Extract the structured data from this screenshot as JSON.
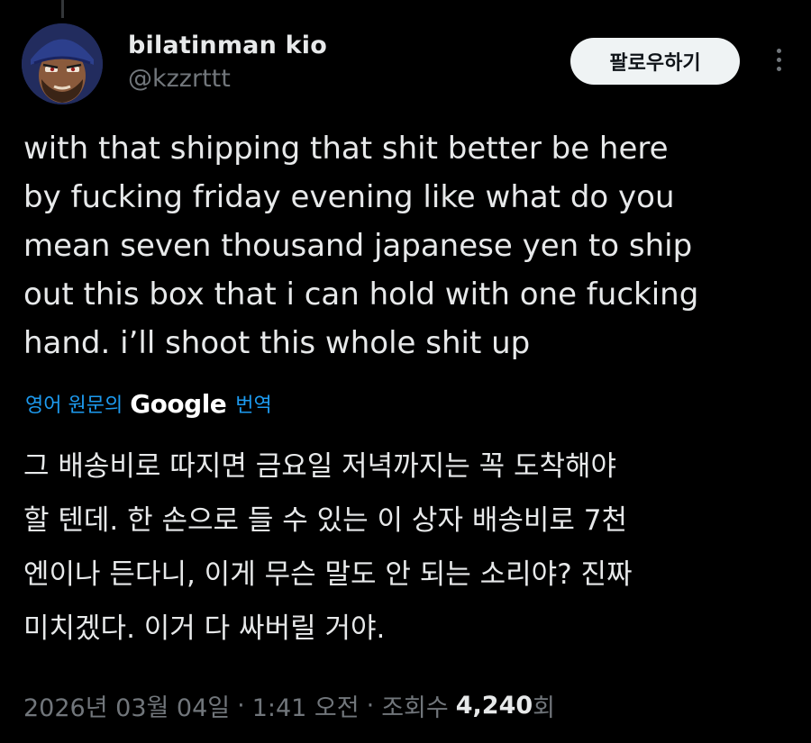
{
  "author": {
    "display_name": "bilatinman kio",
    "handle": "@kzzrttt"
  },
  "actions": {
    "follow_label": "팔로우하기",
    "more_icon": "more-vertical-icon"
  },
  "tweet": {
    "text_lines": [
      "with that shipping that shit better be here",
      "by fucking friday evening like what do you",
      "mean seven thousand japanese yen to ship",
      "out this box that i can hold with one fucking",
      "hand. i’ll shoot this whole shit up"
    ]
  },
  "translation": {
    "prefix": "영어 원문의",
    "provider": "Google",
    "suffix": "번역",
    "lines": [
      "그 배송비로 따지면 금요일 저녁까지는 꼭 도착해야",
      "할 텐데. 한 손으로 들 수 있는 이 상자 배송비로 7천",
      "엔이나 든다니, 이게 무슨 말도 안 되는 소리야? 진짜",
      "미치겠다. 이거 다 싸버릴 거야."
    ]
  },
  "meta": {
    "date": "2026년 03월 04일",
    "separator1": "·",
    "time": "1:41 오전",
    "separator2": "·",
    "views_label": "조회수",
    "views_count": "4,240",
    "views_suffix": "회"
  },
  "colors": {
    "background": "#000000",
    "text_primary": "#e7e9ea",
    "text_secondary": "#71767b",
    "link_blue": "#1d9bf0",
    "follow_button_bg": "#eff3f4"
  }
}
